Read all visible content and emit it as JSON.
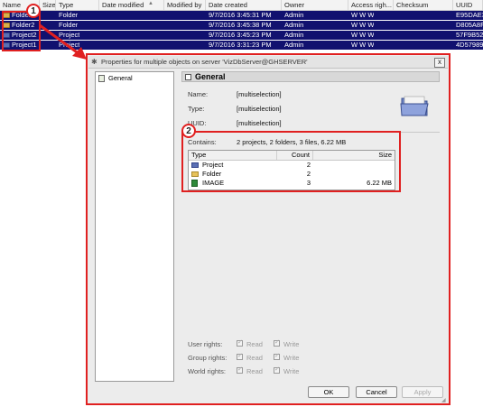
{
  "file_list": {
    "columns": [
      "Name",
      "Size",
      "Type",
      "Date modified",
      "Modified by",
      "Date created",
      "Owner",
      "Access righ...",
      "Checksum",
      "UUID"
    ],
    "rows": [
      {
        "name": "Folder1",
        "type": "Folder",
        "date_created": "9/7/2016 3:45:31 PM",
        "owner": "Admin",
        "access": "W W W",
        "uuid": "E95DAE3",
        "icon": "folder-icon"
      },
      {
        "name": "Folder2",
        "type": "Folder",
        "date_created": "9/7/2016 3:45:38 PM",
        "owner": "Admin",
        "access": "W W W",
        "uuid": "D805A8F",
        "icon": "folder-icon"
      },
      {
        "name": "Project2",
        "type": "Project",
        "date_created": "9/7/2016 3:45:23 PM",
        "owner": "Admin",
        "access": "W W W",
        "uuid": "57F9B529",
        "icon": "project-icon"
      },
      {
        "name": "Project1",
        "type": "Project",
        "date_created": "9/7/2016 3:31:23 PM",
        "owner": "Admin",
        "access": "W W W",
        "uuid": "4D57989",
        "icon": "project-icon"
      }
    ]
  },
  "callouts": {
    "one": "1",
    "two": "2"
  },
  "dialog": {
    "title": "Properties for multiple objects on server 'VizDbServer@GHSERVER'",
    "close_label": "x",
    "tree": {
      "items": [
        {
          "label": "General"
        }
      ]
    },
    "general": {
      "header": "General",
      "name_label": "Name:",
      "name_value": "[multiselection]",
      "type_label": "Type:",
      "type_value": "[multiselection]",
      "uuid_label": "UUID:",
      "uuid_value": "[multiselection]",
      "contains_label": "Contains:",
      "contains_value": "2 projects, 2 folders, 3 files, 6.22 MB"
    },
    "contents_table": {
      "headers": {
        "type": "Type",
        "count": "Count",
        "size": "Size"
      },
      "rows": [
        {
          "type": "Project",
          "count": "2",
          "size": "",
          "icon": "project-icon"
        },
        {
          "type": "Folder",
          "count": "2",
          "size": "",
          "icon": "folder-icon"
        },
        {
          "type": "IMAGE",
          "count": "3",
          "size": "6.22 MB",
          "icon": "image-icon"
        }
      ]
    },
    "rights": {
      "user_label": "User rights:",
      "group_label": "Group rights:",
      "world_label": "World rights:",
      "read_label": "Read",
      "write_label": "Write"
    },
    "buttons": {
      "ok": "OK",
      "cancel": "Cancel",
      "apply": "Apply"
    }
  },
  "colors": {
    "selection": "#11116f",
    "callout": "#e02020",
    "dialog_bg": "#ececec"
  }
}
